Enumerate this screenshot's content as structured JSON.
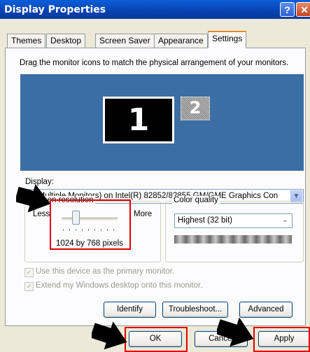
{
  "window": {
    "title": "Display Properties",
    "help_glyph": "?",
    "close_glyph": "✕"
  },
  "tabs": [
    "Themes",
    "Desktop",
    "Screen Saver",
    "Appearance",
    "Settings"
  ],
  "active_tab": "Settings",
  "instructions": "Drag the monitor icons to match the physical arrangement of your monitors.",
  "monitors": [
    {
      "number": "1"
    },
    {
      "number": "2"
    }
  ],
  "display": {
    "label": "Display:",
    "value": "1. (Multiple Monitors) on Intel(R) 82852/82855 GM/GME Graphics Con"
  },
  "screen_resolution": {
    "label": "Screen resolution",
    "less": "Less",
    "more": "More",
    "value": "1024 by 768 pixels",
    "slider_position": 0.2
  },
  "color_quality": {
    "label": "Color quality",
    "value": "Highest (32 bit)"
  },
  "checkboxes": [
    {
      "label": "Use this device as the primary monitor.",
      "checked": true,
      "enabled": false
    },
    {
      "label": "Extend my Windows desktop onto this monitor.",
      "checked": true,
      "enabled": false
    }
  ],
  "buttons": {
    "identify": "Identify",
    "troubleshoot": "Troubleshoot...",
    "advanced": "Advanced",
    "ok": "OK",
    "cancel": "Cancel",
    "apply": "Apply"
  },
  "colors": {
    "titlebar": "#0842b0",
    "desktop_preview": "#3a6ea5",
    "highlight": "#e30000",
    "tab_accent": "#e68b2c"
  }
}
